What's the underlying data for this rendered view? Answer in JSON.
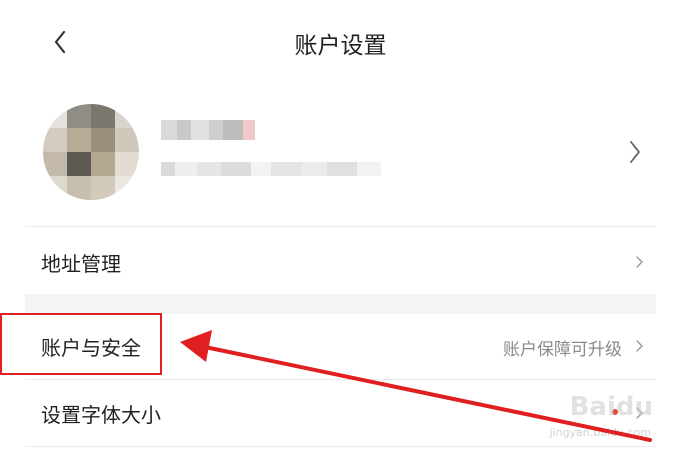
{
  "header": {
    "title": "账户设置"
  },
  "profile": {
    "avatar": "avatar (blurred)"
  },
  "menu": [
    {
      "label": "地址管理",
      "value": ""
    },
    {
      "label": "账户与安全",
      "value": "账户保障可升级"
    },
    {
      "label": "设置字体大小",
      "value": ""
    }
  ],
  "annotation": {
    "highlight_color": "#e02020",
    "arrow_color": "#e02020"
  },
  "watermark": {
    "brand": "Baidu",
    "sub": "jingyan.baidu.com"
  },
  "colors": {
    "background": "#ffffff",
    "secondary_text": "#8a8a8a",
    "dot": "#e8453c"
  }
}
